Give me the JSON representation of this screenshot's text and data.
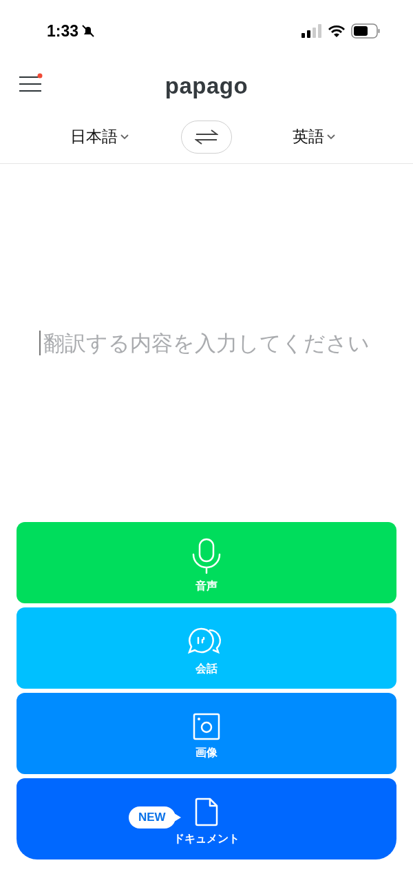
{
  "status_bar": {
    "time": "1:33",
    "silent": true
  },
  "header": {
    "logo": "papago",
    "menu_notification": true
  },
  "languages": {
    "source": "日本語",
    "target": "英語"
  },
  "input": {
    "placeholder": "翻訳する内容を入力してください"
  },
  "modes": [
    {
      "kind": "voice",
      "label": "音声",
      "color": "#00dd5c"
    },
    {
      "kind": "conversation",
      "label": "会話",
      "color": "#00c0ff"
    },
    {
      "kind": "image",
      "label": "画像",
      "color": "#008cff"
    },
    {
      "kind": "document",
      "label": "ドキュメント",
      "color": "#0068ff",
      "badge": "NEW"
    }
  ]
}
